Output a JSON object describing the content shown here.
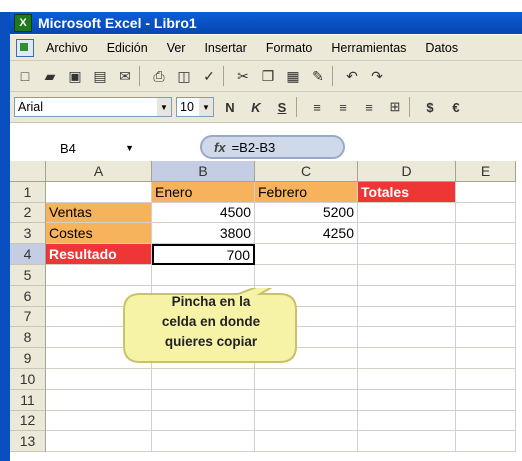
{
  "window": {
    "title": "Microsoft Excel - Libro1"
  },
  "menu": [
    {
      "label": "Archivo"
    },
    {
      "label": "Edición"
    },
    {
      "label": "Ver"
    },
    {
      "label": "Insertar"
    },
    {
      "label": "Formato"
    },
    {
      "label": "Herramientas"
    },
    {
      "label": "Datos"
    }
  ],
  "format_toolbar": {
    "font": "Arial",
    "size": "10"
  },
  "formula_bar": {
    "cell_ref": "B4",
    "formula": "=B2-B3",
    "fx": "fx"
  },
  "grid": {
    "columns": [
      "A",
      "B",
      "C",
      "D",
      "E"
    ],
    "rows": [
      {
        "num": "1",
        "A": "",
        "B": "Enero",
        "C": "Febrero",
        "D": "Totales"
      },
      {
        "num": "2",
        "A": "Ventas",
        "B": "4500",
        "C": "5200",
        "D": ""
      },
      {
        "num": "3",
        "A": "Costes",
        "B": "3800",
        "C": "4250",
        "D": ""
      },
      {
        "num": "4",
        "A": "Resultado",
        "B": "700",
        "C": "",
        "D": ""
      },
      {
        "num": "5",
        "A": "",
        "B": "",
        "C": "",
        "D": ""
      },
      {
        "num": "6",
        "A": "",
        "B": "",
        "C": "",
        "D": ""
      },
      {
        "num": "7",
        "A": "",
        "B": "",
        "C": "",
        "D": ""
      },
      {
        "num": "8",
        "A": "",
        "B": "",
        "C": "",
        "D": ""
      },
      {
        "num": "9",
        "A": "",
        "B": "",
        "C": "",
        "D": ""
      },
      {
        "num": "10",
        "A": "",
        "B": "",
        "C": "",
        "D": ""
      },
      {
        "num": "11",
        "A": "",
        "B": "",
        "C": "",
        "D": ""
      },
      {
        "num": "12",
        "A": "",
        "B": "",
        "C": "",
        "D": ""
      },
      {
        "num": "13",
        "A": "",
        "B": "",
        "C": "",
        "D": ""
      }
    ]
  },
  "callout": {
    "line1": "Pincha en la",
    "line2": "celda en donde",
    "line3": "quieres copiar"
  },
  "colors": {
    "orange_fill": "#f7b35b",
    "red_fill": "#ee3636",
    "titlebar": "#0a5ed8",
    "callout_fill": "#f6f3a7"
  }
}
